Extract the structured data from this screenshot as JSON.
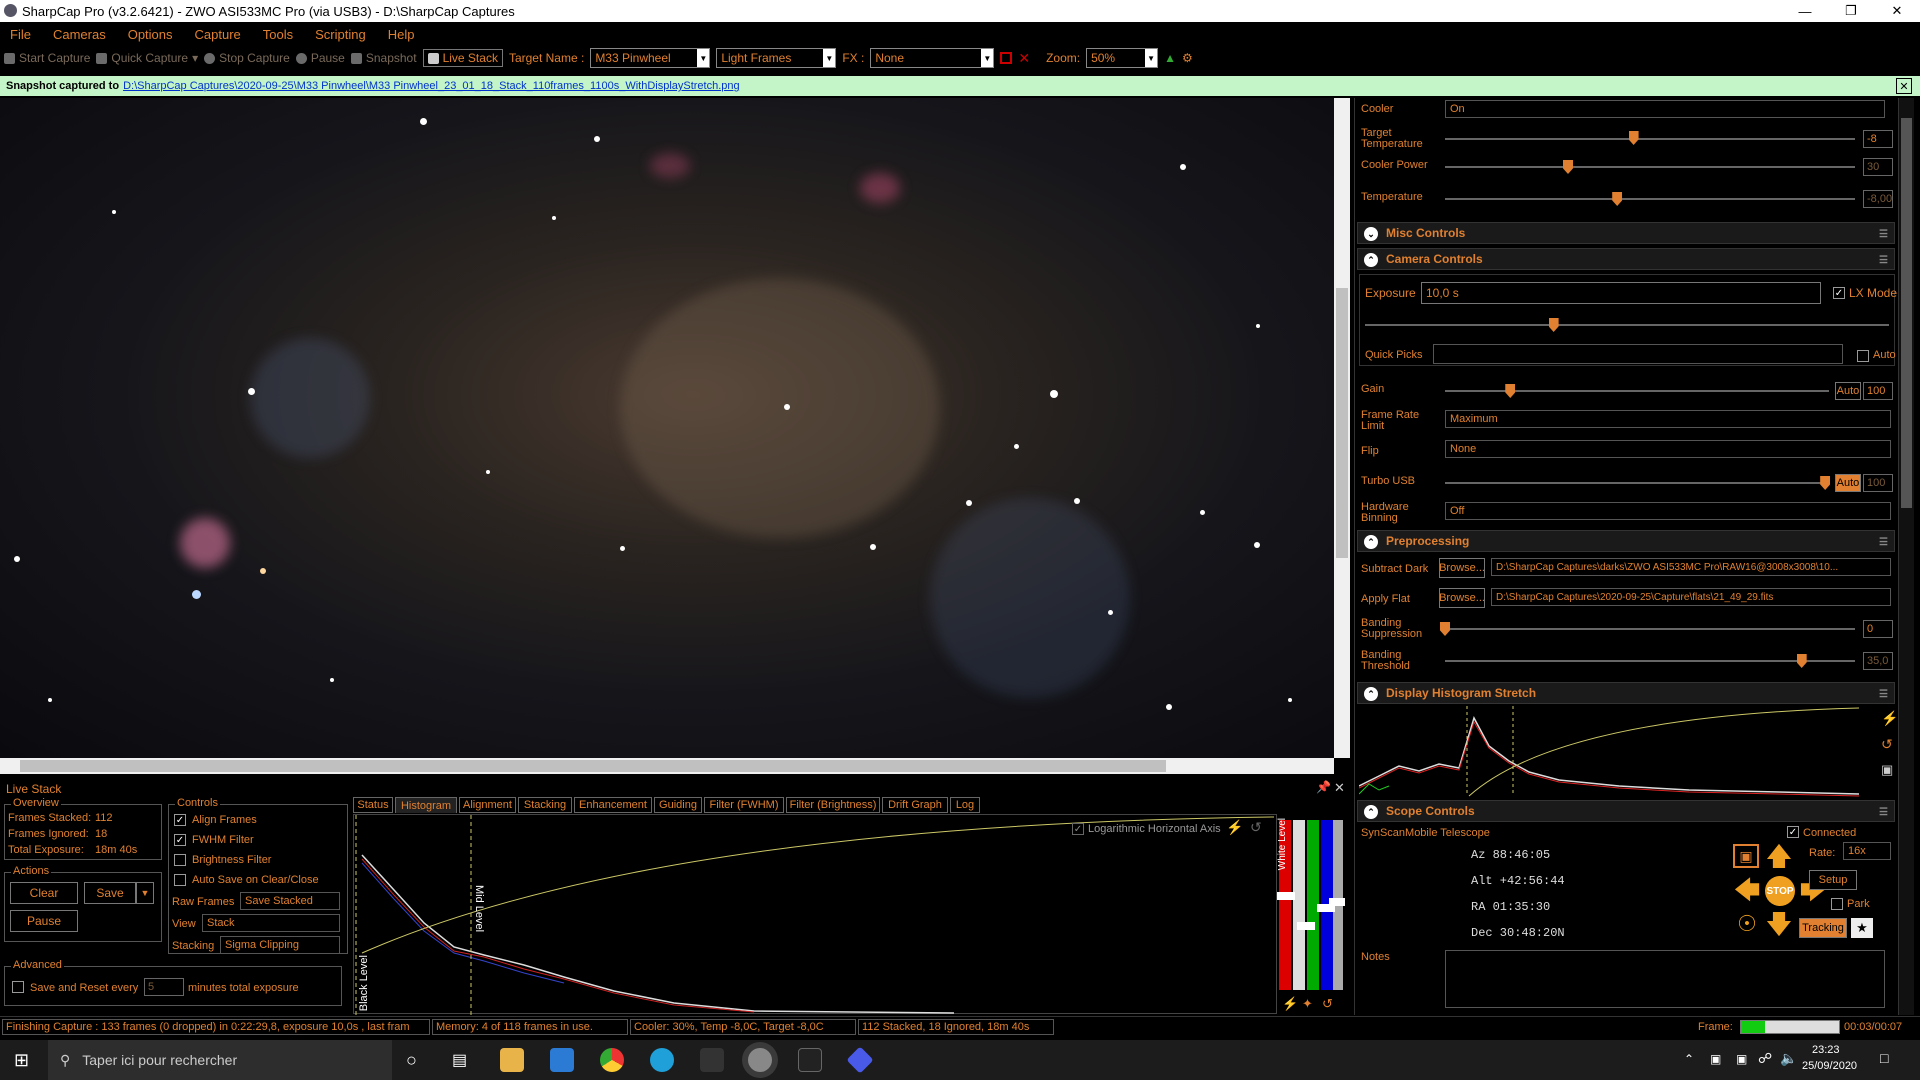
{
  "window": {
    "title": "SharpCap Pro (v3.2.6421) - ZWO ASI533MC Pro (via USB3) - D:\\SharpCap Captures"
  },
  "menu": [
    "File",
    "Cameras",
    "Options",
    "Capture",
    "Tools",
    "Scripting",
    "Help"
  ],
  "toolbar": {
    "start_capture": "Start Capture",
    "quick_capture": "Quick Capture",
    "stop_capture": "Stop Capture",
    "pause": "Pause",
    "snapshot": "Snapshot",
    "live_stack": "Live Stack",
    "target_name_label": "Target Name :",
    "target_name_value": "M33 Pinwheel",
    "frame_type": "Light Frames",
    "fx_label": "FX :",
    "fx_value": "None",
    "zoom_label": "Zoom:",
    "zoom_value": "50%"
  },
  "snapshot_bar": {
    "prefix": "Snapshot captured to",
    "path": "D:\\SharpCap Captures\\2020-09-25\\M33 Pinwheel\\M33 Pinwheel_23_01_18_Stack_110frames_1100s_WithDisplayStretch.png"
  },
  "cooler": {
    "cooler_label": "Cooler",
    "cooler_value": "On",
    "target_temp_label": "Target Temperature",
    "target_temp_value": "-8",
    "target_temp_level": 0.46,
    "cooler_power_label": "Cooler Power",
    "cooler_power_value": "30",
    "cooler_power_level": 0.3,
    "temperature_label": "Temperature",
    "temperature_value": "-8,00",
    "temperature_level": 0.42
  },
  "misc_controls": {
    "title": "Misc Controls"
  },
  "camera_controls": {
    "title": "Camera Controls",
    "exposure_label": "Exposure",
    "exposure_value": "10,0 s",
    "lx_mode": "LX Mode",
    "exposure_level": 0.36,
    "quick_picks_label": "Quick Picks",
    "auto_label": "Auto",
    "gain_label": "Gain",
    "gain_level": 0.17,
    "gain_auto": "Auto",
    "gain_value": "100",
    "frame_rate_label": "Frame Rate Limit",
    "frame_rate_value": "Maximum",
    "flip_label": "Flip",
    "flip_value": "None",
    "turbo_label": "Turbo USB",
    "turbo_level": 0.99,
    "turbo_auto": "Auto",
    "turbo_value": "100",
    "binning_label": "Hardware Binning",
    "binning_value": "Off"
  },
  "preprocessing": {
    "title": "Preprocessing",
    "dark_label": "Subtract Dark",
    "browse": "Browse...",
    "dark_path": "D:\\SharpCap Captures\\darks\\ZWO ASI533MC Pro\\RAW16@3008x3008\\10...",
    "flat_label": "Apply Flat",
    "flat_path": "D:\\SharpCap Captures\\2020-09-25\\Capture\\flats\\21_49_29.fits",
    "banding_supp_label": "Banding Suppression",
    "banding_supp_value": "0",
    "banding_supp_level": 0.0,
    "banding_thr_label": "Banding Threshold",
    "banding_thr_value": "35,0",
    "banding_thr_level": 0.87
  },
  "histogram_stretch": {
    "title": "Display Histogram Stretch"
  },
  "scope": {
    "title": "Scope Controls",
    "name": "SynScanMobile Telescope",
    "connected": "Connected",
    "az": "Az  88:46:05",
    "alt": "Alt +42:56:44",
    "ra": "RA  01:35:30",
    "dec": "Dec 30:48:20N",
    "rate_label": "Rate:",
    "rate_value": "16x",
    "setup": "Setup",
    "park": "Park",
    "stop": "STOP",
    "tracking": "Tracking",
    "notes_label": "Notes"
  },
  "live_stack": {
    "title": "Live Stack",
    "overview_title": "Overview",
    "frames_stacked_label": "Frames Stacked:",
    "frames_stacked": "112",
    "frames_ignored_label": "Frames Ignored:",
    "frames_ignored": "18",
    "total_exposure_label": "Total Exposure:",
    "total_exposure": "18m 40s",
    "actions_title": "Actions",
    "clear": "Clear",
    "save": "Save",
    "pause": "Pause",
    "advanced_title": "Advanced",
    "save_reset_label": "Save and Reset every",
    "save_reset_value": "5",
    "save_reset_suffix": "minutes total exposure",
    "controls_title": "Controls",
    "align_frames": "Align Frames",
    "fwhm_filter": "FWHM Filter",
    "brightness_filter": "Brightness Filter",
    "auto_save": "Auto Save on Clear/Close",
    "raw_frames_label": "Raw Frames",
    "raw_frames_value": "Save Stacked",
    "view_label": "View",
    "view_value": "Stack",
    "stacking_label": "Stacking",
    "stacking_value": "Sigma Clipping",
    "tabs": [
      "Status",
      "Histogram",
      "Alignment",
      "Stacking",
      "Enhancement",
      "Guiding",
      "Filter (FWHM)",
      "Filter (Brightness)",
      "Drift Graph",
      "Log"
    ],
    "log_axis": "Logarithmic Horizontal Axis",
    "black_level": "Black Level",
    "mid_level": "Mid Level",
    "white_level": "White Level"
  },
  "status": {
    "capture": "Finishing Capture : 133 frames (0 dropped) in 0:22:29,8, exposure 10,0s , last fram",
    "memory": "Memory: 4 of 118 frames in use.",
    "cooler": "Cooler: 30%, Temp -8,0C, Target -8,0C",
    "stack": "112 Stacked, 18 Ignored, 18m 40s",
    "frame_label": "Frame:",
    "frame_time": "00:03/00:07"
  },
  "taskbar": {
    "search_placeholder": "Taper ici pour rechercher",
    "time": "23:23",
    "date": "25/09/2020"
  },
  "colors": {
    "accent": "#e08030",
    "snapbar": "#c4f5c8"
  }
}
